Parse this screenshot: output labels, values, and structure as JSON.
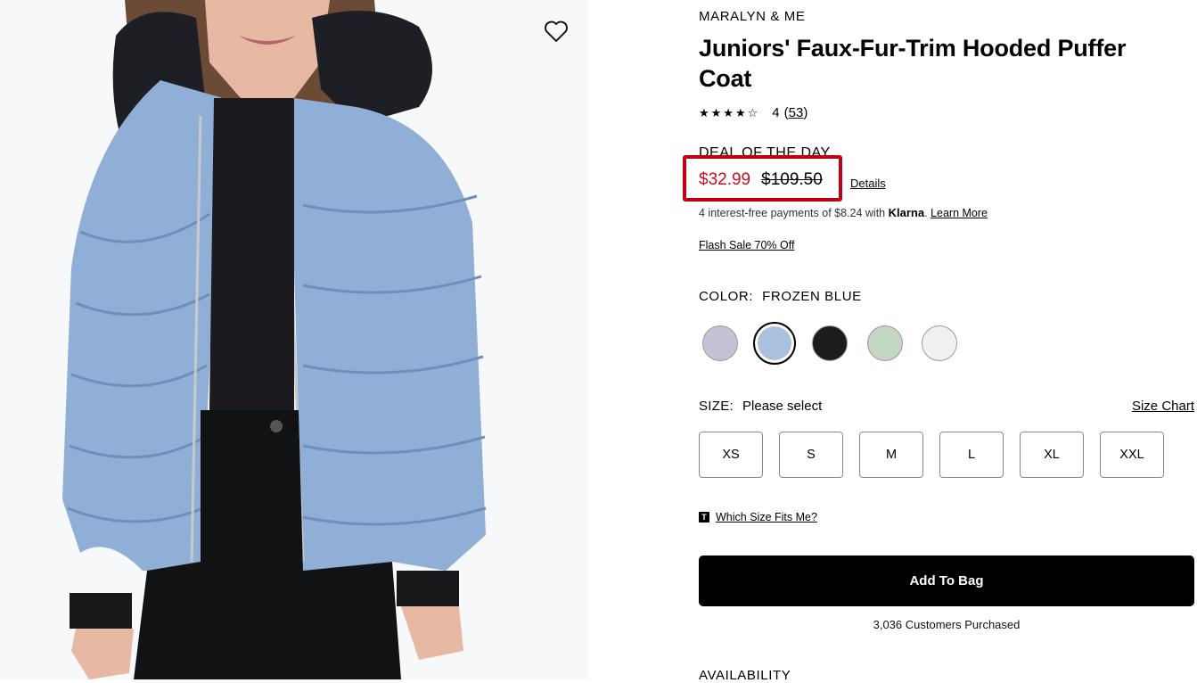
{
  "product": {
    "brand": "MARALYN & ME",
    "title": "Juniors' Faux-Fur-Trim Hooded Puffer Coat",
    "rating": {
      "stars": "★★★★☆",
      "value": "4",
      "count": "53",
      "paren_open": "(",
      "paren_close": ")"
    },
    "deal_label": "DEAL OF THE DAY",
    "price": {
      "sale": "$32.99",
      "original": "$109.50",
      "details_link": "Details",
      "sale_color": "#cc0d1f"
    },
    "klarna": {
      "text": "4 interest-free payments of $8.24 with",
      "brand": "Klarna",
      "dot": ".",
      "learn_more": "Learn More"
    },
    "promo_link": "Flash Sale 70% Off",
    "color": {
      "label": "COLOR:",
      "selected": "FROZEN BLUE",
      "swatches": [
        {
          "name": "lavender gray",
          "hex": "#c3c3d5"
        },
        {
          "name": "frozen blue",
          "hex": "#a9c1df"
        },
        {
          "name": "black",
          "hex": "#1c1c1e"
        },
        {
          "name": "sage",
          "hex": "#c3d5c3"
        },
        {
          "name": "white",
          "hex": "#f0f0ee"
        }
      ]
    },
    "size": {
      "label": "SIZE:",
      "placeholder": "Please select",
      "chart_link": "Size Chart",
      "options": [
        "XS",
        "S",
        "M",
        "L",
        "XL",
        "XXL"
      ]
    },
    "fit_icon": "T",
    "fit_link": "Which Size Fits Me?",
    "add_to_bag": "Add To Bag",
    "purchased": "3,036 Customers Purchased",
    "availability_label": "AVAILABILITY",
    "favorite_icon": "heart-outline-icon",
    "accent_color": "#c0000f"
  }
}
